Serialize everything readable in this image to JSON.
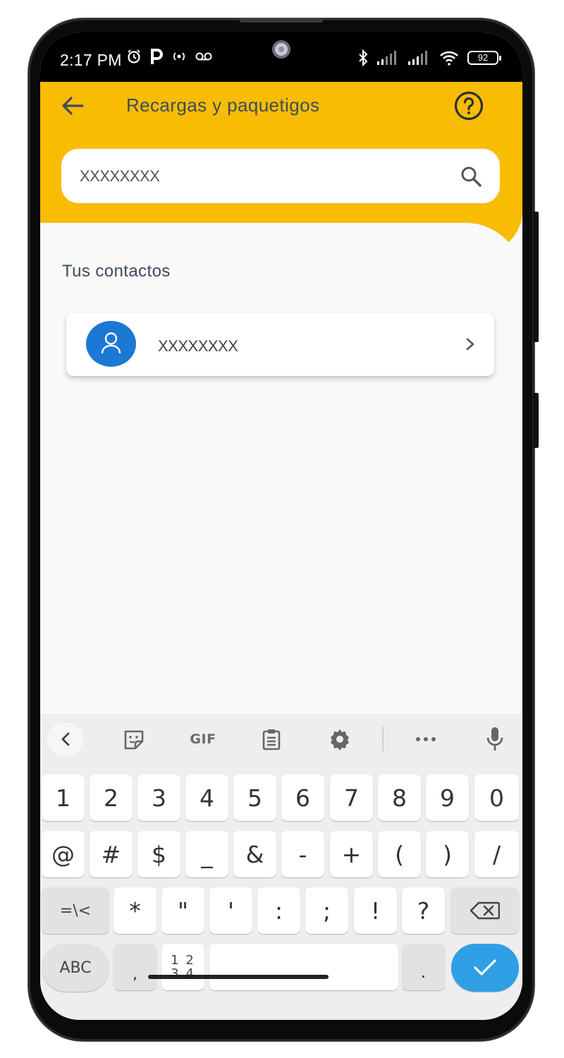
{
  "status_bar": {
    "time": "2:17 PM",
    "battery": "92",
    "icons_left": [
      "alarm-icon",
      "parking-icon",
      "hotspot-icon",
      "voicemail-icon"
    ],
    "icons_right": [
      "bluetooth-icon",
      "signal-icon",
      "signal-icon",
      "wifi-icon",
      "battery-icon"
    ]
  },
  "header": {
    "title": "Recargas y paquetigos",
    "color": "#f8bc03",
    "back_icon": "arrow-left-icon",
    "help_icon": "help-circle-icon"
  },
  "search": {
    "value": "XXXXXXXX",
    "icon": "search-icon"
  },
  "contacts": {
    "section_title": "Tus contactos",
    "items": [
      {
        "name": "XXXXXXXX",
        "avatar_color": "#1c78d4",
        "icon": "person-icon"
      }
    ]
  },
  "keyboard": {
    "toolbar": [
      "chevron-left-icon",
      "sticker-icon",
      "GIF",
      "clipboard-icon",
      "gear-icon",
      "more-icon",
      "mic-icon"
    ],
    "rows": [
      [
        "1",
        "2",
        "3",
        "4",
        "5",
        "6",
        "7",
        "8",
        "9",
        "0"
      ],
      [
        "@",
        "#",
        "$",
        "_",
        "&",
        "-",
        "+",
        "(",
        ")",
        "/"
      ],
      [
        "=\\<",
        "*",
        "\"",
        "'",
        ":",
        ";",
        "!",
        "?",
        "backspace"
      ]
    ],
    "bottom_row": {
      "abc": "ABC",
      "comma": ",",
      "numtoggle_top": "1 2",
      "numtoggle_bottom": "3 4",
      "period": ".",
      "enter_icon": "check-icon"
    },
    "enter_color": "#2f9fe5"
  }
}
